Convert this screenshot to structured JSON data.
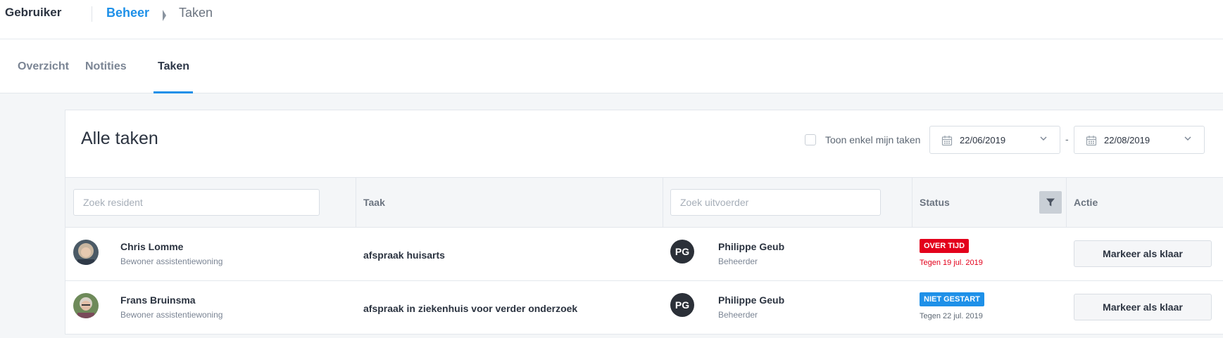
{
  "topbar": {
    "app_name": "Gebruiker",
    "breadcrumb": [
      "Beheer",
      "Taken"
    ]
  },
  "tabs": [
    {
      "label": "Overzicht",
      "active": false
    },
    {
      "label": "Notities",
      "active": false
    },
    {
      "label": "Taken",
      "active": true
    }
  ],
  "panel": {
    "title": "Alle taken",
    "only_mine_label": "Toon enkel mijn taken",
    "only_mine_checked": false,
    "date_from": "22/06/2019",
    "date_separator": "-",
    "date_to": "22/08/2019"
  },
  "table": {
    "resident_search_placeholder": "Zoek resident",
    "task_header": "Taak",
    "executor_search_placeholder": "Zoek uitvoerder",
    "status_header": "Status",
    "action_header": "Actie",
    "rows": [
      {
        "resident_name": "Chris Lomme",
        "resident_role": "Bewoner assistentiewoning",
        "task": "afspraak huisarts",
        "executor_initials": "PG",
        "executor_name": "Philippe Geub",
        "executor_role": "Beheerder",
        "status": "OVER TIJD",
        "status_color": "#e3001b",
        "due": "Tegen 19 jul. 2019",
        "due_color": "#e3001b",
        "action": "Markeer als klaar"
      },
      {
        "resident_name": "Frans Bruinsma",
        "resident_role": "Bewoner assistentiewoning",
        "task": "afspraak in ziekenhuis voor verder onderzoek",
        "executor_initials": "PG",
        "executor_name": "Philippe Geub",
        "executor_role": "Beheerder",
        "status": "NIET GESTART",
        "status_color": "#1e90e8",
        "due": "Tegen 22 jul. 2019",
        "due_color": "#5e6874",
        "action": "Markeer als klaar"
      }
    ]
  },
  "colors": {
    "accent": "#1e90e8",
    "overdue": "#e3001b",
    "not_started": "#1e90e8"
  }
}
